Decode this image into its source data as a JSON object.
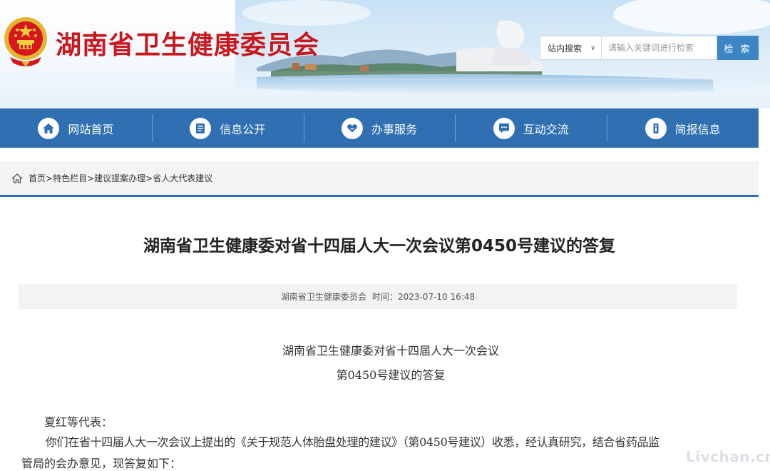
{
  "header": {
    "site_title": "湖南省卫生健康委员会",
    "search": {
      "scope_label": "站内搜索",
      "scope_chevron": "∨",
      "placeholder": "请输入关键词进行检索",
      "button_label": "检 索"
    }
  },
  "nav": {
    "items": [
      {
        "label": "网站首页",
        "icon": "home-icon"
      },
      {
        "label": "信息公开",
        "icon": "document-icon"
      },
      {
        "label": "办事服务",
        "icon": "heart-hand-icon"
      },
      {
        "label": "互动交流",
        "icon": "chat-icon"
      },
      {
        "label": "简报信息",
        "icon": "info-icon"
      }
    ],
    "color": "#2f6fb2"
  },
  "breadcrumb": {
    "items": [
      "首页",
      "特色栏目",
      "建议提案办理",
      "省人大代表建议"
    ],
    "separator": ">"
  },
  "article": {
    "title": "湖南省卫生健康委对省十四届人大一次会议第0450号建议的答复",
    "meta": {
      "source": "湖南省卫生健康委员会",
      "time_label": "时间：",
      "time": "2023-07-10 16:48"
    },
    "doc_head_line1": "湖南省卫生健康委对省十四届人大一次会议",
    "doc_head_line2": "第0450号建议的答复",
    "salutation": "夏红等代表：",
    "paragraph_line1": "你们在省十四届人大一次会议上提出的《关于规范人体胎盘处理的建议》（第0450号建议）收悉，经认真研究，结合省药品监",
    "paragraph_line2": "管局的会办意见，现答复如下："
  },
  "watermark": "Livchan.cn",
  "colors": {
    "title_red": "#c8171d",
    "nav_blue": "#2f6fb2",
    "search_button": "#3d86c6"
  }
}
